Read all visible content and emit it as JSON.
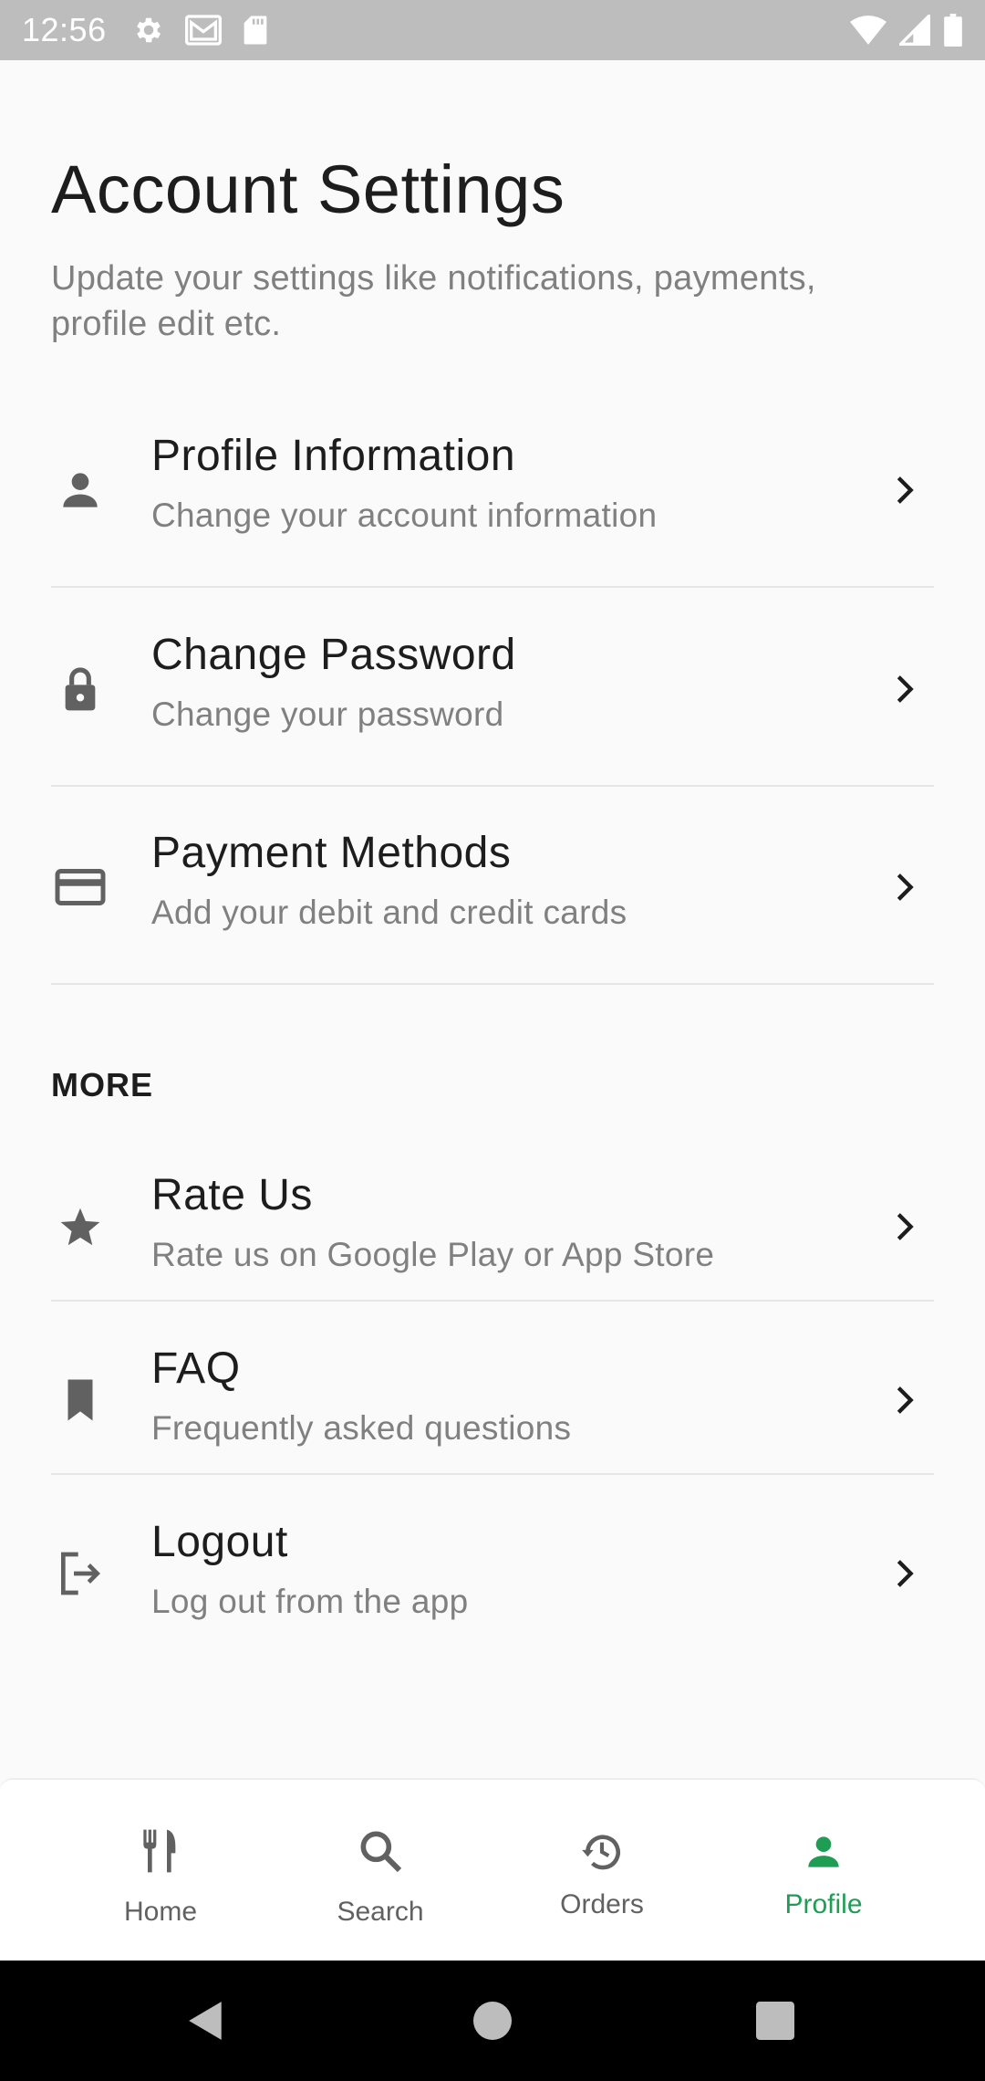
{
  "status_bar": {
    "time": "12:56",
    "left_icons": [
      "gear-icon",
      "gmail-icon",
      "sd-card-icon"
    ],
    "right_icons": [
      "wifi-icon",
      "signal-icon",
      "battery-icon"
    ]
  },
  "header": {
    "title": "Account Settings",
    "subtitle": "Update your settings like notifications, payments, profile edit etc."
  },
  "account_items": [
    {
      "title": "Profile Information",
      "subtitle": "Change your account information",
      "icon": "person-icon"
    },
    {
      "title": "Change Password",
      "subtitle": "Change your password",
      "icon": "lock-icon"
    },
    {
      "title": "Payment Methods",
      "subtitle": "Add your debit and credit cards",
      "icon": "credit-card-icon"
    }
  ],
  "more_section": {
    "label": "MORE",
    "items": [
      {
        "title": "Rate Us",
        "subtitle": "Rate us on Google Play or App Store",
        "icon": "star-icon"
      },
      {
        "title": "FAQ",
        "subtitle": "Frequently asked questions",
        "icon": "bookmark-icon"
      },
      {
        "title": "Logout",
        "subtitle": "Log out from the app",
        "icon": "logout-icon"
      }
    ]
  },
  "bottom_nav": {
    "items": [
      {
        "label": "Home",
        "icon": "restaurant-icon"
      },
      {
        "label": "Search",
        "icon": "search-icon"
      },
      {
        "label": "Orders",
        "icon": "history-icon"
      },
      {
        "label": "Profile",
        "icon": "person-icon",
        "active": true
      }
    ],
    "active_color": "#1f9d55",
    "inactive_color": "#616161"
  },
  "colors": {
    "background": "#fafafa",
    "status_bar": "#bdbdbd",
    "primary_text": "#1d1d1d",
    "secondary_text": "#808080",
    "accent": "#1f9d55"
  }
}
